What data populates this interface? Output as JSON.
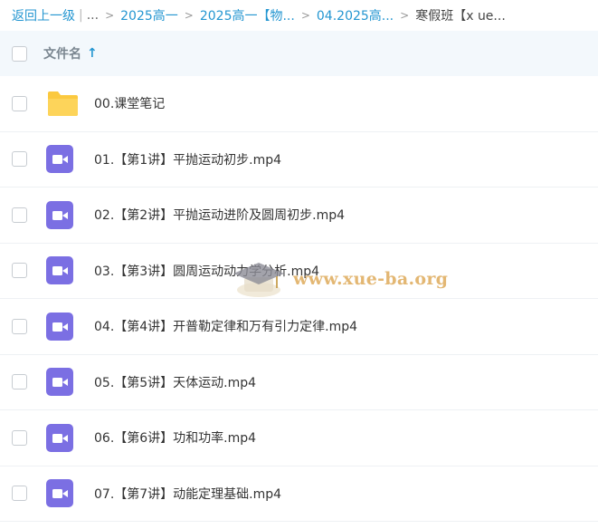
{
  "breadcrumb": {
    "back": "返回上一级",
    "separator": "|",
    "ellipsis": "...",
    "chevron": ">",
    "items": [
      "2025高一",
      "2025高一【物...",
      "04.2025高...",
      "寒假班【x ue..."
    ]
  },
  "header": {
    "column_title": "文件名",
    "sort_arrow": "↑"
  },
  "files": [
    {
      "name": "00.课堂笔记",
      "type": "folder"
    },
    {
      "name": "01.【第1讲】平抛运动初步.mp4",
      "type": "video"
    },
    {
      "name": "02.【第2讲】平抛运动进阶及圆周初步.mp4",
      "type": "video"
    },
    {
      "name": "03.【第3讲】圆周运动动力学分析.mp4",
      "type": "video"
    },
    {
      "name": "04.【第4讲】开普勒定律和万有引力定律.mp4",
      "type": "video"
    },
    {
      "name": "05.【第5讲】天体运动.mp4",
      "type": "video"
    },
    {
      "name": "06.【第6讲】功和功率.mp4",
      "type": "video"
    },
    {
      "name": "07.【第7讲】动能定理基础.mp4",
      "type": "video"
    }
  ],
  "watermark": {
    "text": "www.xue-ba.org"
  },
  "colors": {
    "link": "#2496d1",
    "header_bg": "#f3f8fc",
    "folder": "#fbc93f",
    "video": "#7b6fe3"
  }
}
